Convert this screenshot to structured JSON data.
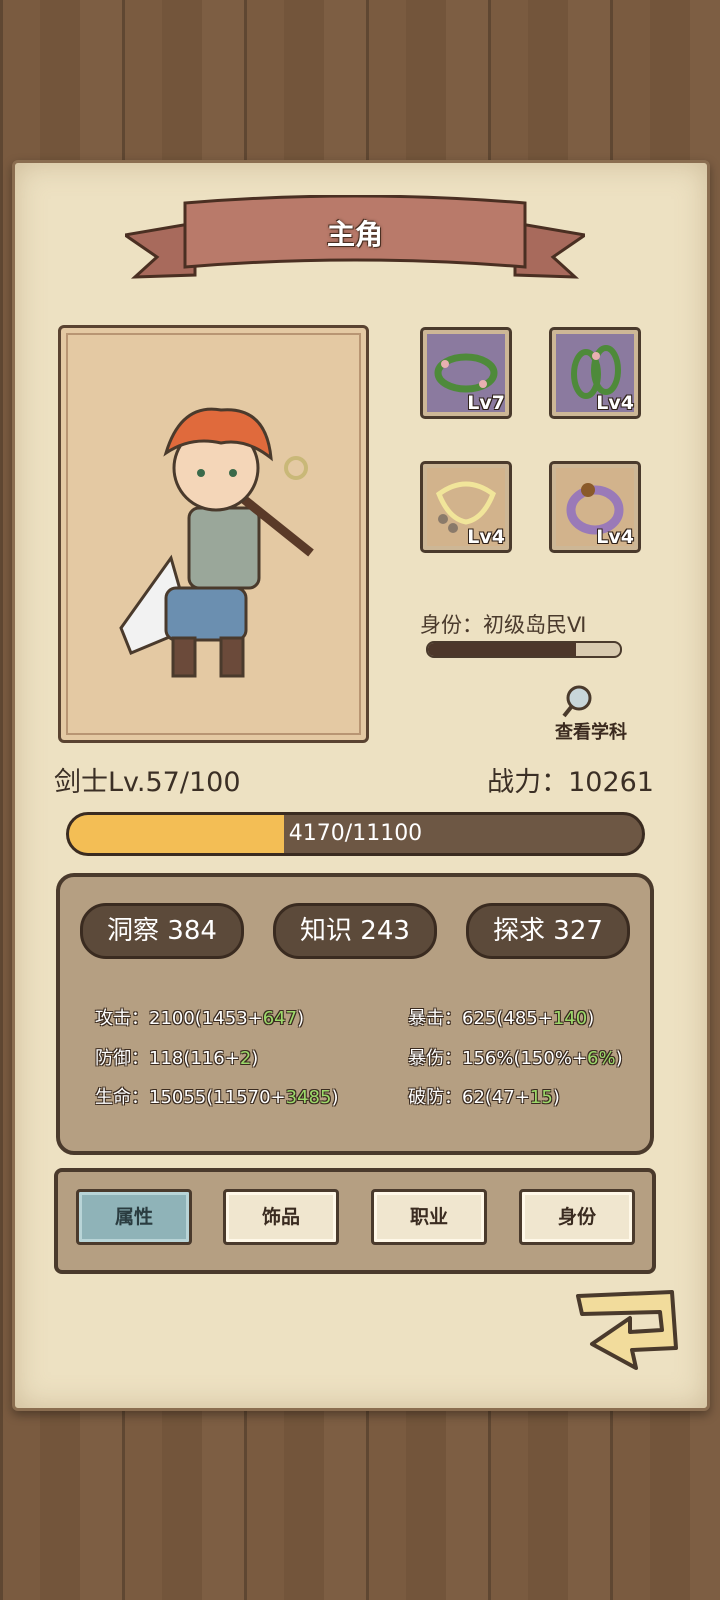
{
  "title": "主角",
  "equipment": [
    {
      "icon": "thorn-wreath-icon",
      "level": "Lv7"
    },
    {
      "icon": "thorn-bracelet-icon",
      "level": "Lv4"
    },
    {
      "icon": "rope-necklace-icon",
      "level": "Lv4"
    },
    {
      "icon": "purple-ring-icon",
      "level": "Lv4"
    }
  ],
  "identity": {
    "label": "身份：初级岛民Ⅵ",
    "progress": 0.77
  },
  "view_subjects": "查看学科",
  "class_level": "剑士Lv.57/100",
  "power": "战力：10261",
  "xp": {
    "text": "4170/11100",
    "current": 4170,
    "max": 11100
  },
  "attributes": [
    "洞察 384",
    "知识 243",
    "探求 327"
  ],
  "stats_left": [
    {
      "label": "攻击：",
      "base": "2100(1453+",
      "bonus": "647",
      "end": ")"
    },
    {
      "label": "防御：",
      "base": "118(116+",
      "bonus": "2",
      "end": ")"
    },
    {
      "label": "生命：",
      "base": "15055(11570+",
      "bonus": "3485",
      "end": ")"
    }
  ],
  "stats_right": [
    {
      "label": "暴击：",
      "base": "625(485+",
      "bonus": "140",
      "end": ")"
    },
    {
      "label": "暴伤：",
      "base": "156%(150%+",
      "bonus": "6%",
      "end": ")"
    },
    {
      "label": "破防：",
      "base": "62(47+",
      "bonus": "15",
      "end": ")"
    }
  ],
  "tabs": [
    "属性",
    "饰品",
    "职业",
    "身份"
  ],
  "active_tab": 0,
  "colors": {
    "paper": "#ede1c2",
    "panel": "#b59f82",
    "xp": "#f3be55",
    "bonus": "#9dd96a"
  }
}
